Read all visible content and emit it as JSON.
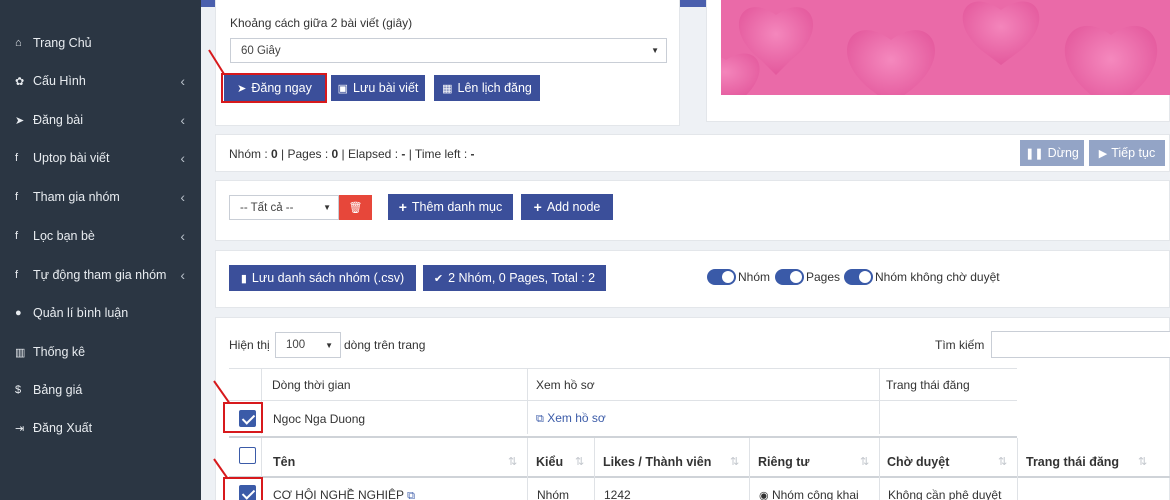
{
  "sidebar": {
    "items": [
      {
        "label": "Trang Chủ",
        "icon": "home-icon",
        "glyph": "⌂",
        "has_arrow": false
      },
      {
        "label": "Cấu Hình",
        "icon": "gear-icon",
        "glyph": "✿",
        "has_arrow": true
      },
      {
        "label": "Đăng bài",
        "icon": "paper-plane-icon",
        "glyph": "➤",
        "has_arrow": true
      },
      {
        "label": "Uptop bài viết",
        "icon": "facebook-icon",
        "glyph": "f",
        "has_arrow": true
      },
      {
        "label": "Tham gia nhóm",
        "icon": "facebook-icon",
        "glyph": "f",
        "has_arrow": true
      },
      {
        "label": "Lọc bạn bè",
        "icon": "facebook-icon",
        "glyph": "f",
        "has_arrow": true
      },
      {
        "label": "Tự động tham gia nhóm",
        "icon": "facebook-icon",
        "glyph": "f",
        "has_arrow": true
      },
      {
        "label": "Quản lí bình luận",
        "icon": "comment-icon",
        "glyph": "●",
        "has_arrow": false
      },
      {
        "label": "Thống kê",
        "icon": "bar-chart-icon",
        "glyph": "▥",
        "has_arrow": false
      },
      {
        "label": "Bảng giá",
        "icon": "dollar-icon",
        "glyph": "$",
        "has_arrow": false
      },
      {
        "label": "Đăng Xuất",
        "icon": "sign-out-icon",
        "glyph": "⇥",
        "has_arrow": false
      }
    ],
    "arrow_glyph": "‹"
  },
  "post_settings": {
    "interval_label": "Khoảng cách giữa 2 bài viết (giây)",
    "interval_value": "60 Giây",
    "post_now": "Đăng ngay",
    "save_post": "Lưu bài viết",
    "schedule": "Lên lịch đăng"
  },
  "progress": {
    "groups_label": "Nhóm : ",
    "groups_value": "0",
    "pages_label": " | Pages : ",
    "pages_value": "0",
    "elapsed_label": " | Elapsed : ",
    "elapsed_value": "-",
    "timeleft_label": " | Time left : ",
    "timeleft_value": "-",
    "stop": "Dừng",
    "continue": "Tiếp tục"
  },
  "category": {
    "select_value": "-- Tất cả --",
    "add_category": "Thêm danh mục",
    "add_node": "Add node"
  },
  "list_bar": {
    "save_csv": "Lưu danh sách nhóm (.csv)",
    "summary": "2 Nhóm, 0 Pages, Total : 2",
    "toggle_groups": "Nhóm",
    "toggle_pages": "Pages",
    "toggle_no_approval": "Nhóm không chờ duyệt"
  },
  "table_controls": {
    "show_label": "Hiện thị",
    "page_size": "100",
    "per_page_label": "dòng trên trang",
    "search_label": "Tìm kiếm"
  },
  "timeline_table": {
    "headers": [
      "Dòng thời gian",
      "Xem hồ sơ",
      "Trang thái đăng"
    ],
    "row": {
      "name": "Ngoc Nga Duong",
      "profile_link": "Xem hồ sơ"
    }
  },
  "groups_table": {
    "headers": [
      "Tên",
      "Kiểu",
      "Likes / Thành viên",
      "Riêng tư",
      "Chờ duyệt",
      "Trang thái đăng"
    ],
    "rows": [
      {
        "name": "CƠ HỘI NGHỀ NGHIỆP",
        "type": "Nhóm",
        "members": "1242",
        "privacy": "Nhóm công khai",
        "approval": "Không cần phê duyệt",
        "status": ""
      }
    ]
  },
  "colors": {
    "sidebar_bg": "#2b3643",
    "primary_button": "#3b4f9a",
    "disabled_button": "#93a4c6",
    "annotation_red": "#d7191c",
    "delete_button": "#e7473a"
  }
}
